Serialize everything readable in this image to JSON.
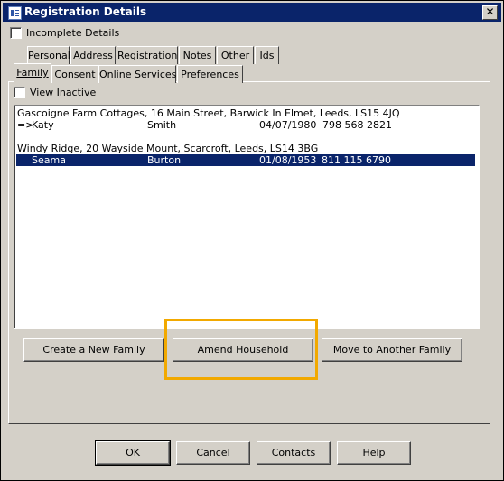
{
  "window": {
    "title": "Registration Details",
    "title_icon": "form-icon",
    "close_glyph": "✕"
  },
  "incomplete_details": {
    "label": "Incomplete Details",
    "checked": false
  },
  "tabs_row_back": [
    "Personal",
    "Address",
    "Registration",
    "Notes",
    "Other",
    "Ids"
  ],
  "tabs_row_front": [
    "Family",
    "Consent",
    "Online Services",
    "Preferences"
  ],
  "active_tab": "Family",
  "view_inactive": {
    "label": "View Inactive",
    "checked": false
  },
  "households": [
    {
      "address": "Gascoigne Farm Cottages, 16 Main Street, Barwick In Elmet, Leeds, LS15 4JQ",
      "members": [
        {
          "prefix": "=>",
          "first": "Katy",
          "last": "Smith",
          "dob": "04/07/1980",
          "nhs": "798 568 2821",
          "selected": false
        }
      ]
    },
    {
      "address": "Windy Ridge, 20 Wayside Mount, Scarcroft, Leeds, LS14 3BG",
      "members": [
        {
          "prefix": "",
          "first": "Seama",
          "last": "Burton",
          "dob": "01/08/1953",
          "nhs": "811 115 6790",
          "selected": true
        }
      ]
    }
  ],
  "family_buttons": {
    "create": "Create a New Family",
    "amend": "Amend Household",
    "move": "Move to Another Family"
  },
  "dialog_buttons": {
    "ok": "OK",
    "cancel": "Cancel",
    "contacts": "Contacts",
    "help": "Help"
  },
  "colors": {
    "title_bar": "#0a246a",
    "selection": "#0a246a",
    "highlight_box": "#f2a900",
    "face": "#d4d0c8"
  }
}
